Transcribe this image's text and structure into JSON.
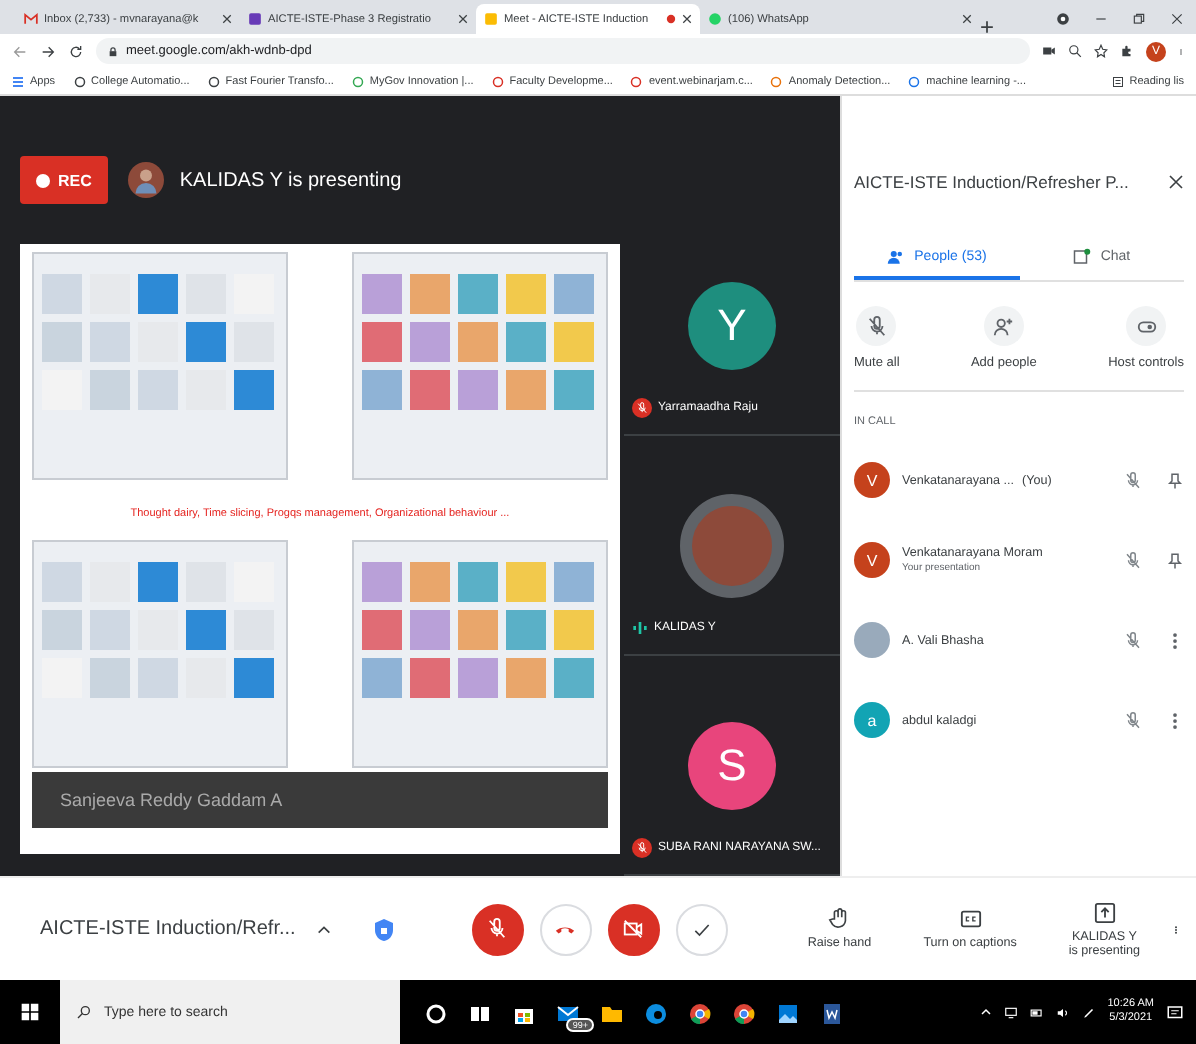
{
  "browser": {
    "tabs": [
      {
        "title": "Inbox (2,733) - mvnarayana@k",
        "kind": "mail",
        "selected": false
      },
      {
        "title": "AICTE-ISTE-Phase 3 Registratio",
        "kind": "form",
        "selected": false
      },
      {
        "title": "Meet - AICTE-ISTE Induction",
        "kind": "meet",
        "selected": true,
        "recording": true
      },
      {
        "title": "(106) WhatsApp",
        "kind": "chat",
        "selected": false
      }
    ],
    "address": "meet.google.com/akh-wdnb-dpd",
    "profile_initial": "V",
    "bookmarks": [
      "Apps",
      "College Automatio...",
      "Fast Fourier Transfo...",
      "MyGov Innovation |...",
      "Faculty Developme...",
      "event.webinarjam.c...",
      "Anomaly Detection...",
      "machine learning -..."
    ],
    "reading_list": "Reading lis"
  },
  "meet": {
    "rec_label": "REC",
    "presenter_banner": "KALIDAS Y is presenting",
    "slide": {
      "caption": "Thought dairy, Time slicing, Progqs management, Organizational behaviour ...",
      "overlay_name": "Sanjeeva Reddy Gaddam A"
    },
    "tiles": [
      {
        "name": "Yarramaadha Raju",
        "initial": "Y",
        "kind": "letter",
        "color": "#1e8e7e",
        "muted": true
      },
      {
        "name": "KALIDAS Y",
        "kind": "photo",
        "muted": false
      },
      {
        "name": "SUBA RANI NARAYANA SW...",
        "initial": "S",
        "kind": "letter",
        "color": "#e8457c",
        "muted": true
      }
    ],
    "panel": {
      "title": "AICTE-ISTE Induction/Refresher P...",
      "tabs": [
        {
          "label": "People (53)",
          "kind": "people",
          "selected": true
        },
        {
          "label": "Chat",
          "kind": "chat",
          "selected": false
        }
      ],
      "actions": [
        {
          "label": "Mute all",
          "kind": "mute"
        },
        {
          "label": "Add people",
          "kind": "add"
        },
        {
          "label": "Host controls",
          "kind": "host"
        }
      ],
      "section": "IN CALL",
      "participants": [
        {
          "name": "Venkatanarayana ...",
          "suffix": "(You)",
          "initial": "V",
          "kind": "letter",
          "color": "#c5421c",
          "muted": true,
          "pin": true
        },
        {
          "name": "Venkatanarayana Moram",
          "subtitle": "Your presentation",
          "initial": "V",
          "kind": "letter",
          "color": "#c5421c",
          "muted": true,
          "pin": true
        },
        {
          "name": "A. Vali Bhasha",
          "kind": "photo",
          "muted": true,
          "pin": false
        },
        {
          "name": "abdul kaladgi",
          "initial": "a",
          "kind": "letter",
          "color": "#12a4b4",
          "muted": true,
          "pin": false
        }
      ]
    },
    "bottom": {
      "meeting_title": "AICTE-ISTE Induction/Refr...",
      "mic_on": false,
      "camera_on": false,
      "actions": [
        {
          "label": "Raise hand",
          "kind": "hand"
        },
        {
          "label": "Turn on captions",
          "kind": "captions"
        },
        {
          "label": "KALIDAS Y\nis presenting",
          "kind": "present"
        }
      ]
    }
  },
  "taskbar": {
    "search_placeholder": "Type here to search",
    "mail_badge": "99+",
    "time": "10:26 AM",
    "date": "5/3/2021"
  }
}
